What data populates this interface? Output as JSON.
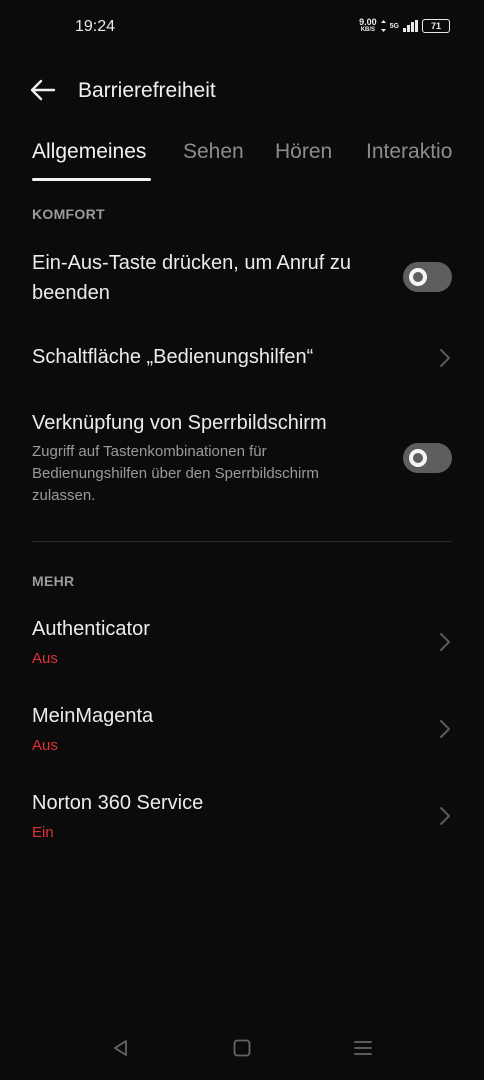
{
  "status_bar": {
    "time": "19:24",
    "net_speed_value": "9.00",
    "net_speed_unit": "KB/S",
    "network_type": "5G",
    "battery_level": "71"
  },
  "header": {
    "back_icon": "arrow-left-icon",
    "title": "Barrierefreiheit"
  },
  "tabs": [
    {
      "label": "Allgemeines",
      "active": true
    },
    {
      "label": "Sehen",
      "active": false
    },
    {
      "label": "Hören",
      "active": false
    },
    {
      "label": "Interaktio",
      "active": false
    }
  ],
  "sections": {
    "komfort": "KOMFORT",
    "mehr": "MEHR"
  },
  "komfort_items": [
    {
      "label_line1": "Ein-Aus-Taste drücken, um Anruf zu",
      "label_line2": "beenden",
      "toggle": false
    },
    {
      "label": "Schaltfläche „Bedienungshilfen“",
      "chevron": true
    },
    {
      "label": "Verknüpfung von Sperrbildschirm",
      "desc_line1": "Zugriff auf Tastenkombinationen für",
      "desc_line2": "Bedienungshilfen über den Sperrbildschirm",
      "desc_line3": "zulassen.",
      "toggle": false
    }
  ],
  "mehr_items": [
    {
      "label": "Authenticator",
      "status": "Aus"
    },
    {
      "label": "MeinMagenta",
      "status": "Aus"
    },
    {
      "label": "Norton 360 Service",
      "status": "Ein"
    }
  ],
  "colors": {
    "background": "#0b0b0b",
    "status_red": "#e0303a",
    "toggle_off": "#5e5e5e"
  },
  "nav_icons": [
    "back-triangle-icon",
    "home-square-icon",
    "recents-menu-icon"
  ]
}
